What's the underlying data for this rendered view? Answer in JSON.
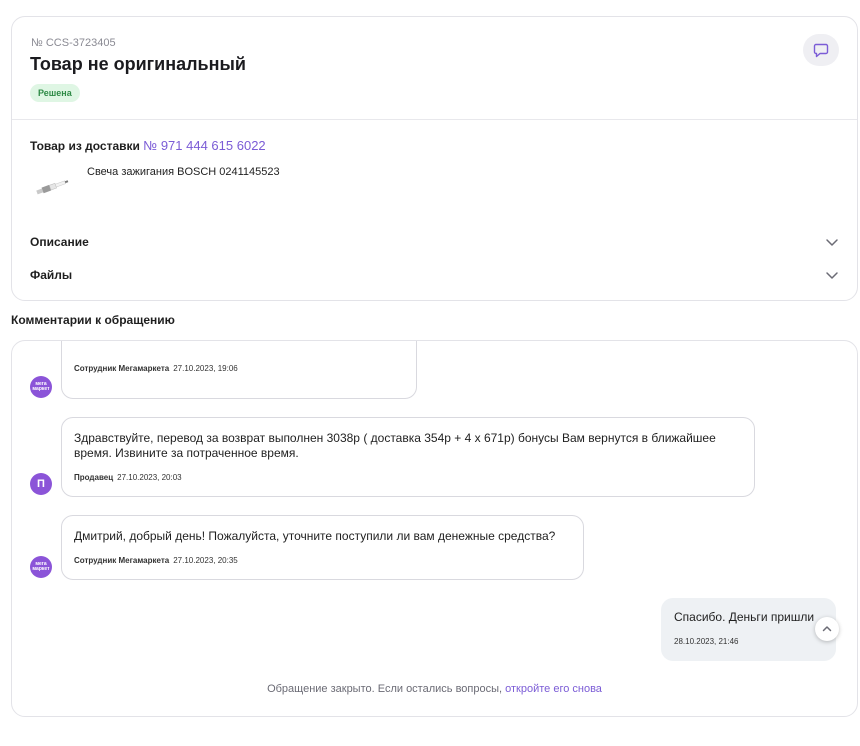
{
  "ticket": {
    "number": "№ CCS-3723405",
    "title": "Товар не оригинальный",
    "status": "Решена"
  },
  "delivery": {
    "label": "Товар из доставки",
    "number": "№ 971 444 615 6022"
  },
  "product": {
    "name": "Свеча зажигания BOSCH 0241145523"
  },
  "accordions": {
    "description": "Описание",
    "files": "Файлы"
  },
  "comments": {
    "title": "Комментарии к обращению",
    "messages": [
      {
        "text": "",
        "author": "Сотрудник Мегамаркета",
        "time": "27.10.2023, 19:06",
        "avatar": "мега маркет"
      },
      {
        "text": "Здравствуйте, перевод за возврат выполнен 3038р ( доставка 354р + 4 х 671р) бонусы Вам вернутся в ближайшее время. Извините за потраченное время.",
        "author": "Продавец",
        "time": "27.10.2023, 20:03",
        "avatar": "П"
      },
      {
        "text": "Дмитрий, добрый день! Пожалуйста, уточните поступили ли вам денежные средства?",
        "author": "Сотрудник Мегамаркета",
        "time": "27.10.2023, 20:35",
        "avatar": "мега маркет"
      },
      {
        "text": "Спасибо. Деньги пришли",
        "author": "",
        "time": "28.10.2023, 21:46"
      }
    ],
    "closed_note": "Обращение закрыто. Если остались вопросы,",
    "reopen_link": "откройте его снова"
  },
  "colors": {
    "accent": "#7b5cd6",
    "avatar": "#8b54d8",
    "status_bg": "#dff6e4",
    "status_text": "#2e8a46"
  },
  "icons": [
    "chat-icon",
    "chevron-down-icon",
    "chevron-up-icon",
    "spark-plug-image"
  ]
}
